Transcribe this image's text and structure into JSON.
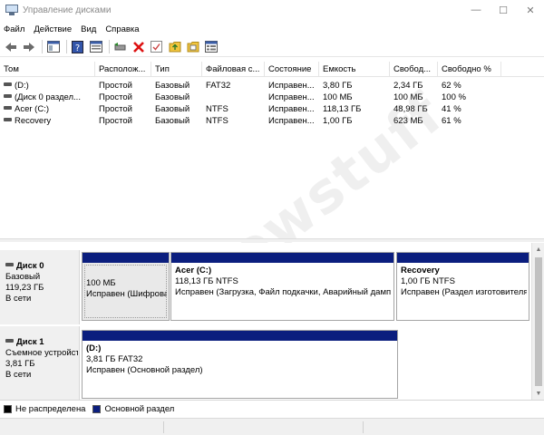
{
  "window": {
    "title": "Управление дисками",
    "minimize_glyph": "—",
    "maximize_glyph": "☐",
    "close_glyph": "✕"
  },
  "menu": {
    "items": [
      "Файл",
      "Действие",
      "Вид",
      "Справка"
    ]
  },
  "toolbar": {
    "icons": [
      "back-icon",
      "forward-icon",
      "console-tree-icon",
      "help-icon",
      "properties-icon",
      "connect-drive-icon",
      "delete-icon",
      "check-icon",
      "up-folder-icon",
      "new-folder-icon",
      "list-view-icon"
    ]
  },
  "volume_list": {
    "columns": [
      "Том",
      "Располож...",
      "Тип",
      "Файловая с...",
      "Состояние",
      "Емкость",
      "Свобод...",
      "Свободно %"
    ],
    "rows": [
      [
        "(D:)",
        "Простой",
        "Базовый",
        "FAT32",
        "Исправен...",
        "3,80 ГБ",
        "2,34 ГБ",
        "62 %"
      ],
      [
        "(Диск 0 раздел...",
        "Простой",
        "Базовый",
        "",
        "Исправен...",
        "100 МБ",
        "100 МБ",
        "100 %"
      ],
      [
        "Acer (C:)",
        "Простой",
        "Базовый",
        "NTFS",
        "Исправен...",
        "118,13 ГБ",
        "48,98 ГБ",
        "41 %"
      ],
      [
        "Recovery",
        "Простой",
        "Базовый",
        "NTFS",
        "Исправен...",
        "1,00 ГБ",
        "623 МБ",
        "61 %"
      ]
    ]
  },
  "disks": [
    {
      "name": "Диск 0",
      "type": "Базовый",
      "size": "119,23 ГБ",
      "state": "В сети",
      "partitions": [
        {
          "name": "",
          "size": "100 МБ",
          "status": "Исправен (Шифрованный EFI системный раздел)"
        },
        {
          "name": "Acer  (C:)",
          "size": "118,13 ГБ NTFS",
          "status": "Исправен (Загрузка, Файл подкачки, Аварийный дамп памяти, Основной раздел)"
        },
        {
          "name": "Recovery",
          "size": "1,00 ГБ NTFS",
          "status": "Исправен (Раздел изготовителя OEM)"
        }
      ]
    },
    {
      "name": "Диск 1",
      "type": "Съемное устройство",
      "size": "3,81 ГБ",
      "state": "В сети",
      "partitions": [
        {
          "name": "(D:)",
          "size": "3,81 ГБ FAT32",
          "status": "Исправен (Основной раздел)"
        }
      ]
    }
  ],
  "legend": {
    "items": [
      {
        "label": "Не распределена",
        "color": "#000000"
      },
      {
        "label": "Основной раздел",
        "color": "#0b1e7e"
      }
    ]
  },
  "watermark": "howstuff"
}
